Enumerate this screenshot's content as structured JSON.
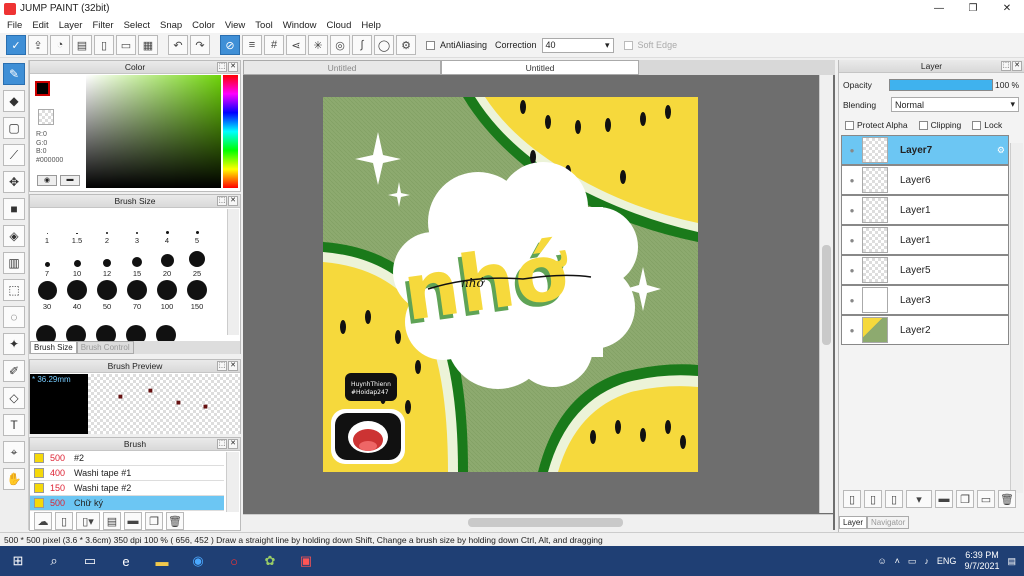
{
  "window": {
    "title": "JUMP PAINT (32bit)",
    "minimize": "—",
    "restore": "❐",
    "close": "✕"
  },
  "menu": [
    "File",
    "Edit",
    "Layer",
    "Filter",
    "Select",
    "Snap",
    "Color",
    "View",
    "Tool",
    "Window",
    "Cloud",
    "Help"
  ],
  "toolbar": {
    "antialiasing_label": "AntiAliasing",
    "correction_label": "Correction",
    "correction_value": "40",
    "soft_edge_label": "Soft Edge"
  },
  "color_panel": {
    "title": "Color",
    "r": "R:0",
    "g": "G:0",
    "b": "B:0",
    "hex": "#000000"
  },
  "brush_size_panel": {
    "title": "Brush Size",
    "sizes": [
      "1",
      "1.5",
      "2",
      "3",
      "4",
      "5",
      "7",
      "10",
      "12",
      "15",
      "20",
      "25",
      "30",
      "40",
      "50",
      "70",
      "100",
      "150"
    ],
    "tab_active": "Brush Size",
    "tab_inactive": "Brush Control"
  },
  "brush_preview": {
    "title": "Brush Preview",
    "size_label": "* 36.29mm"
  },
  "brush_panel": {
    "title": "Brush",
    "items": [
      {
        "size": "500",
        "name": "#2"
      },
      {
        "size": "400",
        "name": "Washi tape #1"
      },
      {
        "size": "150",
        "name": "Washi tape #2"
      },
      {
        "size": "500",
        "name": "Chữ ký"
      }
    ]
  },
  "tabs": {
    "first": "Untitled",
    "second": "Untitled"
  },
  "artwork": {
    "word": "nhớ",
    "sticker_line1": "HuynhThienn",
    "sticker_line2": "#Hoidap247"
  },
  "layer_panel": {
    "title": "Layer",
    "opacity_label": "Opacity",
    "opacity_value": "100 %",
    "opacity_level": 1.0,
    "blending_label": "Blending",
    "blending_value": "Normal",
    "protect_alpha": "Protect Alpha",
    "clipping": "Clipping",
    "lock": "Lock",
    "layers": [
      "Layer7",
      "Layer6",
      "Layer1",
      "Layer1",
      "Layer5",
      "Layer3",
      "Layer2"
    ],
    "tab_layer": "Layer",
    "tab_navigator": "Navigator"
  },
  "status": {
    "text": "500 * 500 pixel   (3.6 * 3.6cm)   350 dpi   100 %   ( 656, 452 )   Draw a straight line by holding down Shift, Change a brush size by holding down Ctrl, Alt, and dragging"
  },
  "taskbar": {
    "language": "ENG",
    "time": "6:39 PM",
    "date": "9/7/2021"
  },
  "colors": {
    "accent": "#3f8fd6",
    "canvas_bg": "#6e6e6e",
    "taskbar": "#1f3f74",
    "layer_selected": "#6cc6f3"
  }
}
